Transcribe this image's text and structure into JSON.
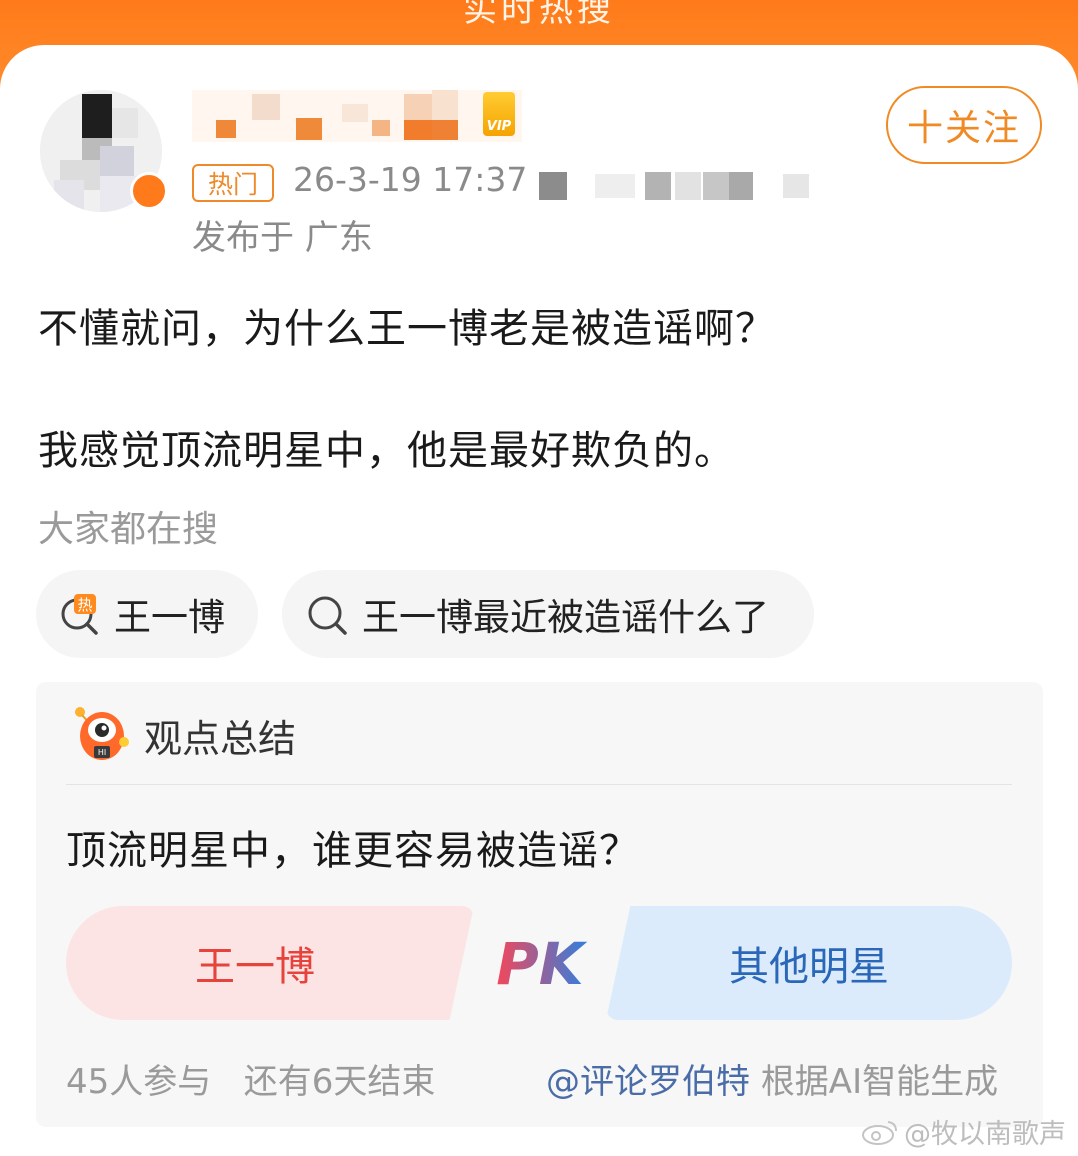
{
  "header": {
    "title": "实时热搜"
  },
  "post": {
    "follow_label": "十关注",
    "hot_tag": "热门",
    "timestamp": "26-3-19 17:37",
    "location": "发布于 广东",
    "body": [
      "不懂就问，为什么王一博老是被造谣啊？",
      "我感觉顶流明星中，他是最好欺负的。"
    ]
  },
  "search": {
    "heading": "大家都在搜",
    "chips": [
      "王一博",
      "王一博最近被造谣什么了"
    ]
  },
  "summary_card": {
    "title": "观点总结",
    "question": "顶流明星中，谁更容易被造谣？",
    "option_left": "王一博",
    "vs_label": "PK",
    "option_right": "其他明星",
    "participants": "45人参与",
    "ends_in": "还有6天结束",
    "mention": "@评论罗伯特",
    "generated_note": "根据AI智能生成"
  },
  "watermark": "@牧以南歌声",
  "colors": {
    "brand_orange": "#ff7a1a",
    "follow_orange": "#f08a24",
    "vote_red": "#e5433c",
    "vote_blue": "#2a67b8",
    "mention_blue": "#4a6da8"
  }
}
